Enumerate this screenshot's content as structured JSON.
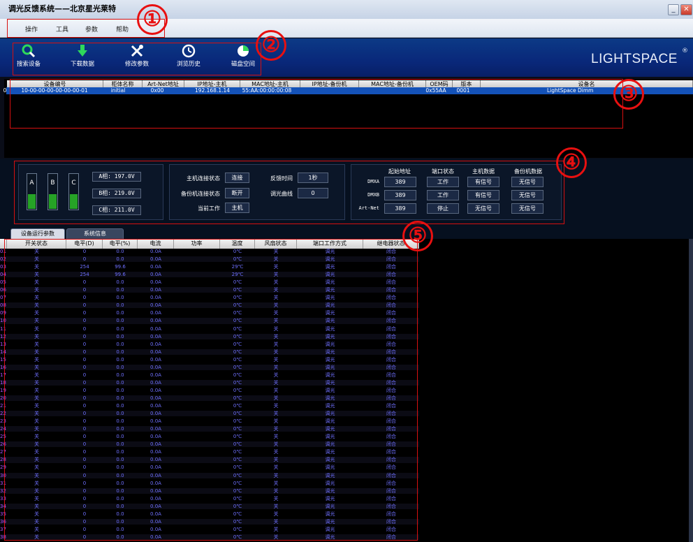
{
  "window": {
    "title": "调光反馈系统——北京星光莱特"
  },
  "menu": [
    "操作",
    "工具",
    "参数",
    "帮助"
  ],
  "toolbar": {
    "buttons": [
      {
        "label": "搜索设备",
        "icon": "search-icon"
      },
      {
        "label": "下载数据",
        "icon": "download-arrow-icon"
      },
      {
        "label": "修改参数",
        "icon": "tools-icon"
      },
      {
        "label": "浏览历史",
        "icon": "clock-icon"
      },
      {
        "label": "磁盘空间",
        "icon": "pie-chart-icon"
      }
    ],
    "logo": "LIGHTSPACE",
    "reg": "®"
  },
  "devices": {
    "columns": [
      "设备编号",
      "柜体名称",
      "Art-Net地址",
      "IP地址-主机",
      "MAC地址-主机",
      "IP地址-备份机",
      "MAC地址-备份机",
      "OEM码",
      "版本",
      "设备名"
    ],
    "rows": [
      {
        "idx": "0",
        "id": "10-00-00-00-00-00-00-01",
        "cabinet": "initial",
        "artnet": "0x00",
        "ip_main": "192.168.1.14",
        "mac_main": "55:AA:00:00:00:08",
        "ip_backup": "",
        "mac_backup": "",
        "oem": "0x55AA",
        "version": "0001",
        "name": "LightSpace Dimm"
      }
    ]
  },
  "phases": {
    "labels": [
      "A",
      "B",
      "C"
    ],
    "values": [
      "A相: 197.0V",
      "B相: 219.0V",
      "C相: 211.0V"
    ]
  },
  "status": {
    "main_conn_label": "主机连接状态",
    "main_conn_value": "连接",
    "feedback_label": "反馈时间",
    "feedback_value": "1秒",
    "backup_conn_label": "备份机连接状态",
    "backup_conn_value": "断开",
    "curve_label": "调光曲线",
    "curve_value": "0",
    "current_label": "当前工作",
    "current_value": "主机"
  },
  "ports": {
    "headers": [
      "起始地址",
      "端口状态",
      "主机数据",
      "备份机数据"
    ],
    "rows": [
      {
        "name": "DMXA",
        "addr": "389",
        "state": "工作",
        "main": "有信号",
        "backup": "无信号"
      },
      {
        "name": "DMXB",
        "addr": "389",
        "state": "工作",
        "main": "有信号",
        "backup": "无信号"
      },
      {
        "name": "Art-Net",
        "addr": "389",
        "state": "停止",
        "main": "无信号",
        "backup": "无信号"
      }
    ]
  },
  "tabs": [
    "设备运行参数",
    "系统信息"
  ],
  "channels": {
    "columns": [
      "开关状态",
      "电平(D)",
      "电平(%)",
      "电流",
      "功率",
      "温度",
      "风扇状态",
      "端口工作方式",
      "继电器状态"
    ],
    "rows": [
      [
        "01",
        "关",
        "0",
        "0.0",
        "0.0A",
        "0℃",
        "关",
        "调光",
        "闭合"
      ],
      [
        "02",
        "关",
        "0",
        "0.0",
        "0.0A",
        "0℃",
        "关",
        "调光",
        "闭合"
      ],
      [
        "03",
        "关",
        "254",
        "99.6",
        "0.0A",
        "29℃",
        "关",
        "调光",
        "闭合"
      ],
      [
        "04",
        "关",
        "254",
        "99.6",
        "0.0A",
        "29℃",
        "关",
        "调光",
        "闭合"
      ],
      [
        "05",
        "关",
        "0",
        "0.0",
        "0.0A",
        "0℃",
        "关",
        "调光",
        "闭合"
      ],
      [
        "06",
        "关",
        "0",
        "0.0",
        "0.0A",
        "0℃",
        "关",
        "调光",
        "闭合"
      ],
      [
        "07",
        "关",
        "0",
        "0.0",
        "0.0A",
        "0℃",
        "关",
        "调光",
        "闭合"
      ],
      [
        "08",
        "关",
        "0",
        "0.0",
        "0.0A",
        "0℃",
        "关",
        "调光",
        "闭合"
      ],
      [
        "09",
        "关",
        "0",
        "0.0",
        "0.0A",
        "0℃",
        "关",
        "调光",
        "闭合"
      ],
      [
        "10",
        "关",
        "0",
        "0.0",
        "0.0A",
        "0℃",
        "关",
        "调光",
        "闭合"
      ],
      [
        "11",
        "关",
        "0",
        "0.0",
        "0.0A",
        "0℃",
        "关",
        "调光",
        "闭合"
      ],
      [
        "12",
        "关",
        "0",
        "0.0",
        "0.0A",
        "0℃",
        "关",
        "调光",
        "闭合"
      ],
      [
        "13",
        "关",
        "0",
        "0.0",
        "0.0A",
        "0℃",
        "关",
        "调光",
        "闭合"
      ],
      [
        "14",
        "关",
        "0",
        "0.0",
        "0.0A",
        "0℃",
        "关",
        "调光",
        "闭合"
      ],
      [
        "15",
        "关",
        "0",
        "0.0",
        "0.0A",
        "0℃",
        "关",
        "调光",
        "闭合"
      ],
      [
        "16",
        "关",
        "0",
        "0.0",
        "0.0A",
        "0℃",
        "关",
        "调光",
        "闭合"
      ],
      [
        "17",
        "关",
        "0",
        "0.0",
        "0.0A",
        "0℃",
        "关",
        "调光",
        "闭合"
      ],
      [
        "18",
        "关",
        "0",
        "0.0",
        "0.0A",
        "0℃",
        "关",
        "调光",
        "闭合"
      ],
      [
        "19",
        "关",
        "0",
        "0.0",
        "0.0A",
        "0℃",
        "关",
        "调光",
        "闭合"
      ],
      [
        "20",
        "关",
        "0",
        "0.0",
        "0.0A",
        "0℃",
        "关",
        "调光",
        "闭合"
      ],
      [
        "21",
        "关",
        "0",
        "0.0",
        "0.0A",
        "0℃",
        "关",
        "调光",
        "闭合"
      ],
      [
        "22",
        "关",
        "0",
        "0.0",
        "0.0A",
        "0℃",
        "关",
        "调光",
        "闭合"
      ],
      [
        "23",
        "关",
        "0",
        "0.0",
        "0.0A",
        "0℃",
        "关",
        "调光",
        "闭合"
      ],
      [
        "24",
        "关",
        "0",
        "0.0",
        "0.0A",
        "0℃",
        "关",
        "调光",
        "闭合"
      ],
      [
        "25",
        "关",
        "0",
        "0.0",
        "0.0A",
        "0℃",
        "关",
        "调光",
        "闭合"
      ],
      [
        "26",
        "关",
        "0",
        "0.0",
        "0.0A",
        "0℃",
        "关",
        "调光",
        "闭合"
      ],
      [
        "27",
        "关",
        "0",
        "0.0",
        "0.0A",
        "0℃",
        "关",
        "调光",
        "闭合"
      ],
      [
        "28",
        "关",
        "0",
        "0.0",
        "0.0A",
        "0℃",
        "关",
        "调光",
        "闭合"
      ],
      [
        "29",
        "关",
        "0",
        "0.0",
        "0.0A",
        "0℃",
        "关",
        "调光",
        "闭合"
      ],
      [
        "30",
        "关",
        "0",
        "0.0",
        "0.0A",
        "0℃",
        "关",
        "调光",
        "闭合"
      ],
      [
        "31",
        "关",
        "0",
        "0.0",
        "0.0A",
        "0℃",
        "关",
        "调光",
        "闭合"
      ],
      [
        "32",
        "关",
        "0",
        "0.0",
        "0.0A",
        "0℃",
        "关",
        "调光",
        "闭合"
      ],
      [
        "33",
        "关",
        "0",
        "0.0",
        "0.0A",
        "0℃",
        "关",
        "调光",
        "闭合"
      ],
      [
        "34",
        "关",
        "0",
        "0.0",
        "0.0A",
        "0℃",
        "关",
        "调光",
        "闭合"
      ],
      [
        "35",
        "关",
        "0",
        "0.0",
        "0.0A",
        "0℃",
        "关",
        "调光",
        "闭合"
      ],
      [
        "36",
        "关",
        "0",
        "0.0",
        "0.0A",
        "0℃",
        "关",
        "调光",
        "闭合"
      ],
      [
        "37",
        "关",
        "0",
        "0.0",
        "0.0A",
        "0℃",
        "关",
        "调光",
        "闭合"
      ],
      [
        "38",
        "关",
        "0",
        "0.0",
        "0.0A",
        "0℃",
        "关",
        "调光",
        "闭合"
      ]
    ]
  },
  "annotations": [
    "①",
    "②",
    "③",
    "④",
    "⑤"
  ],
  "colors": {
    "toolbar": "#0a2a7a",
    "selected_row": "#1452b8",
    "table_text": "#6f70ff",
    "annotation": "#e81010"
  }
}
